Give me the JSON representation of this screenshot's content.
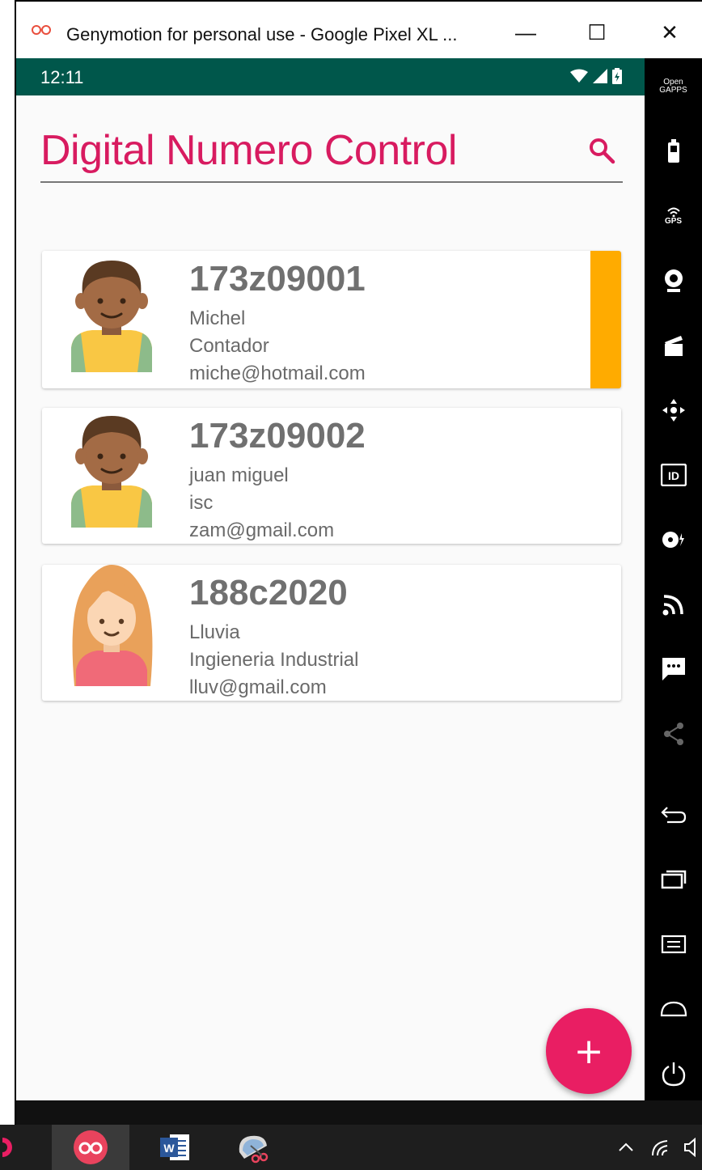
{
  "window": {
    "title": "Genymotion for personal use - Google Pixel XL ...",
    "minimize_label": "—",
    "maximize_label": "☐",
    "close_label": "✕"
  },
  "statusbar": {
    "time": "12:11"
  },
  "app": {
    "title": "Digital Numero Control",
    "accent_color": "#d81b60",
    "fab_label": "+"
  },
  "contacts": [
    {
      "id": "173z09001",
      "name": "Michel",
      "career": "Contador",
      "email": "miche@hotmail.com",
      "avatar": "boy-avatar",
      "selected": true
    },
    {
      "id": "173z09002",
      "name": "juan miguel",
      "career": "isc",
      "email": "zam@gmail.com",
      "avatar": "boy-avatar",
      "selected": false
    },
    {
      "id": "188c2020",
      "name": "Lluvia",
      "career": "Ingieneria Industrial",
      "email": "lluv@gmail.com",
      "avatar": "girl-avatar",
      "selected": false
    }
  ],
  "sidebar": {
    "open_gapps": [
      "Open",
      "GAPPS"
    ],
    "gps_label": "GPS",
    "id_label": "ID",
    "icons": [
      "battery-icon",
      "gps-icon",
      "webcam-icon",
      "clapper-icon",
      "dpad-icon",
      "id-icon",
      "disk-icon",
      "cast-icon",
      "sms-icon",
      "share-icon",
      "back-icon",
      "recents-icon",
      "menu-icon",
      "home-icon",
      "power-icon"
    ]
  },
  "taskbar": {
    "word_label": "W",
    "icons": [
      "genymotion-icon",
      "word-icon",
      "snipping-tool-icon",
      "chevron-up-icon",
      "network-icon",
      "volume-icon"
    ]
  }
}
